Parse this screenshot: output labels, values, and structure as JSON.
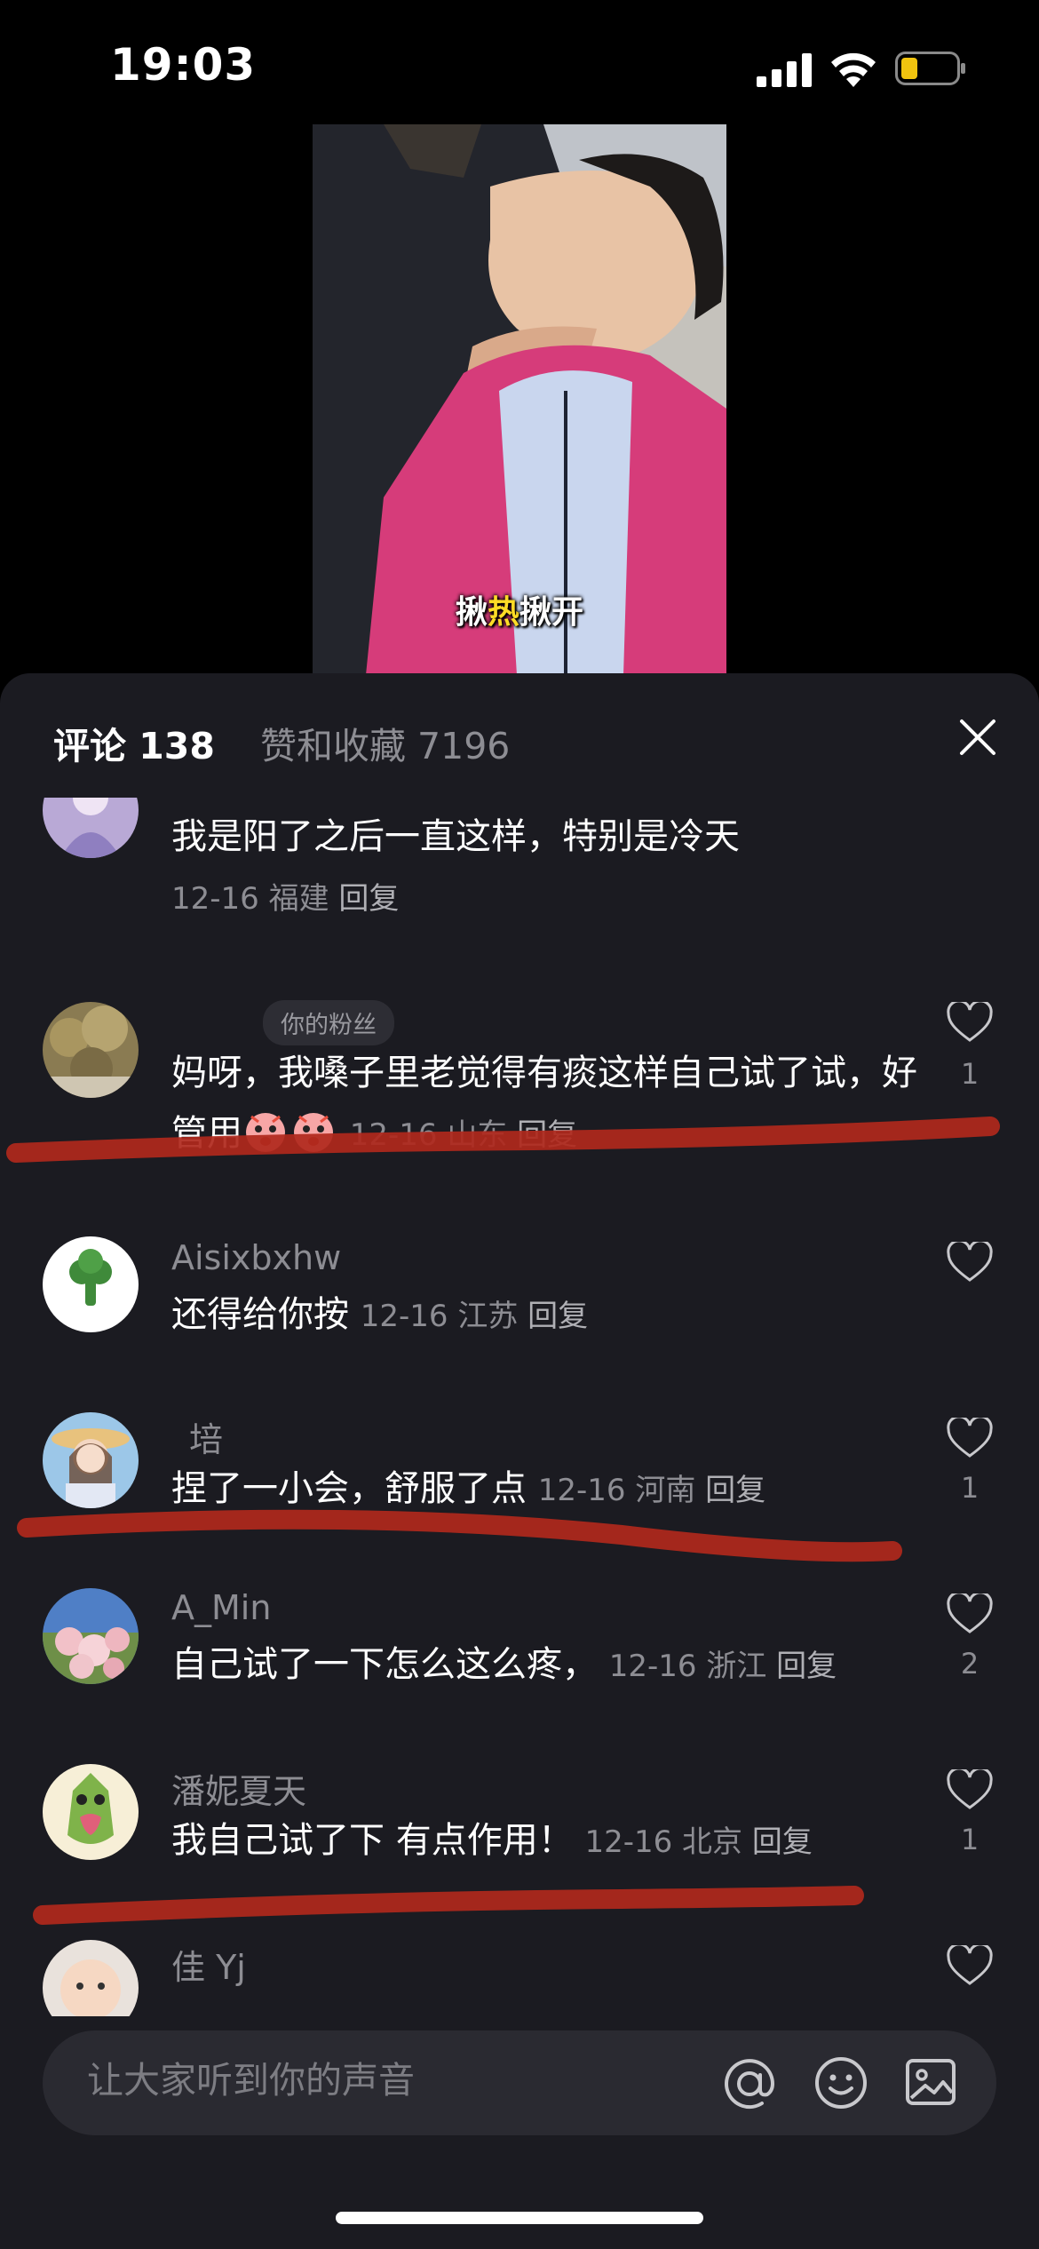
{
  "status_bar": {
    "time": "19:03",
    "icons": [
      "signal-icon",
      "wifi-icon",
      "battery-icon"
    ],
    "battery_color": "#f1c40f"
  },
  "video": {
    "caption_before": "揪",
    "caption_highlight": "热",
    "caption_after": "揪开"
  },
  "comments_panel": {
    "tab_comments": "评论 138",
    "tab_likes": "赞和收藏 7196",
    "close_icon": "close-icon",
    "comments": [
      {
        "username": "",
        "text": "我是阳了之后一直这样，特别是冷天",
        "date": "12-16",
        "location": "福建",
        "reply_label": "回复",
        "likes": ""
      },
      {
        "username": "",
        "badge": "你的粉丝",
        "text": "妈呀，我嗓子里老觉得有痰这样自己试了试，好管用",
        "date": "12-16",
        "location": "山东",
        "reply_label": "回复",
        "likes": "1"
      },
      {
        "username": "Aisixbxhw",
        "text": "还得给你按",
        "date": "12-16",
        "location": "江苏",
        "reply_label": "回复",
        "likes": ""
      },
      {
        "username": "培",
        "text": "捏了一小会，舒服了点",
        "date": "12-16",
        "location": "河南",
        "reply_label": "回复",
        "likes": "1"
      },
      {
        "username": "A_Min",
        "text": "自己试了一下怎么这么疼，",
        "date": "12-16",
        "location": "浙江",
        "reply_label": "回复",
        "likes": "2"
      },
      {
        "username": "潘妮夏天",
        "text": "我自己试了下  有点作用！",
        "date": "12-16",
        "location": "北京",
        "reply_label": "回复",
        "likes": "1"
      },
      {
        "username": "佳 Yj",
        "text": "",
        "likes": ""
      }
    ]
  },
  "input_bar": {
    "placeholder": "让大家听到你的声音",
    "icons": [
      "at-icon",
      "emoji-icon",
      "image-icon"
    ]
  },
  "colors": {
    "panel_background": "#1b1b21",
    "secondary_text": "#8d8d93",
    "annotation_red": "#b0281c"
  }
}
